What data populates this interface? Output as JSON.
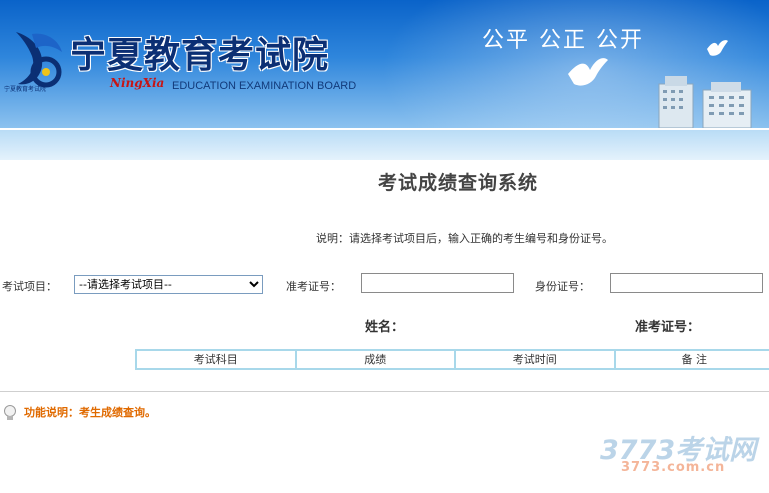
{
  "header": {
    "site_title": "宁夏教育考试院",
    "pinyin_logo": "NingXia",
    "english_name": "EDUCATION EXAMINATION BOARD",
    "slogan": "公平 公正 公开",
    "logo_caption": "宁夏教育考试院"
  },
  "main": {
    "system_title": "考试成绩查询系统",
    "instructions": "说明：请选择考试项目后，输入正确的考生编号和身份证号。",
    "form": {
      "exam_item_label": "考试项目：",
      "exam_item_selected": "--请选择考试项目--",
      "exam_ticket_label": "准考证号：",
      "exam_ticket_value": "",
      "id_number_label": "身份证号：",
      "id_number_value": ""
    },
    "result": {
      "name_label": "姓名：",
      "ticket_label": "准考证号："
    },
    "table": {
      "columns": [
        "考试科目",
        "成绩",
        "考试时间",
        "备 注"
      ]
    }
  },
  "footer": {
    "function_note": "功能说明：考生成绩查询。"
  },
  "watermark": {
    "brand": "3773考试网",
    "url": "3773.com.cn"
  },
  "colors": {
    "banner_blue": "#0a63c9",
    "title_navy": "#0b2f74",
    "table_border": "#a8d8ea",
    "note_orange": "#e06a00"
  }
}
